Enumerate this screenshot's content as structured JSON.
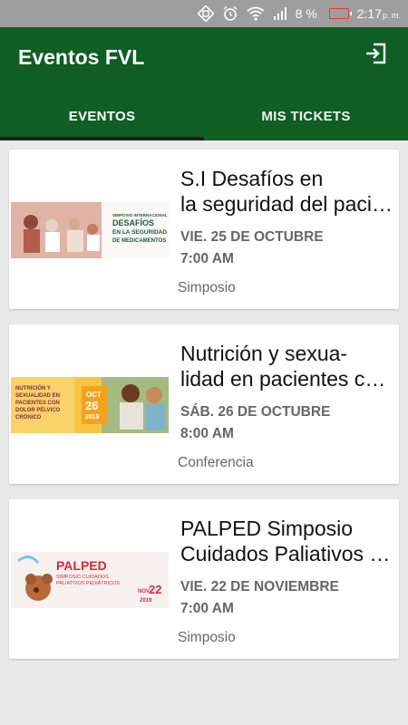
{
  "status_bar": {
    "battery_percent": "8 %",
    "time": "2:17",
    "ampm": "p. m.",
    "icons": [
      "screenshot-icon",
      "alarm-icon",
      "wifi-icon",
      "signal-icon",
      "battery-icon"
    ],
    "battery_color": "#e53935"
  },
  "app_bar": {
    "title": "Eventos FVL",
    "logout_icon": "logout-icon",
    "color": "#0f5e23"
  },
  "tabs": [
    {
      "label": "EVENTOS",
      "active": true
    },
    {
      "label": "MIS TICKETS",
      "active": false
    }
  ],
  "events": [
    {
      "title_line1": "S.I Desafíos en",
      "title_line2": "la seguridad del paciente",
      "date": "VIE. 25 DE OCTUBRE",
      "time": "7:00 AM",
      "type": "Simposio",
      "thumb_text": [
        "SIMPOSIO INTERNACIONAL",
        "DESAFÍOS",
        "EN LA SEGURIDAD",
        "DE MEDICAMENTOS"
      ]
    },
    {
      "title_line1": "Nutrición y sexua-",
      "title_line2": "lidad en pacientes con dolor",
      "date": "SÁB. 26 DE OCTUBRE",
      "time": "8:00 AM",
      "type": "Conferencia",
      "thumb_text": [
        "NUTRICIÓN Y",
        "SEXUALIDAD EN",
        "PACIENTES CON",
        "DOLOR PÉLVICO",
        "CRÓNICO",
        "OCT",
        "26",
        "2019"
      ]
    },
    {
      "title_line1": "PALPED Simposio",
      "title_line2": "Cuidados Paliativos Pediátricos",
      "date": "VIE. 22 DE NOVIEMBRE",
      "time": "7:00 AM",
      "type": "Simposio",
      "thumb_text": [
        "PALPED",
        "SIMPOSIO CUIDADOS",
        "PALIATIVOS PEDIÁTRICOS",
        "NOV",
        "22",
        "2019"
      ]
    }
  ]
}
